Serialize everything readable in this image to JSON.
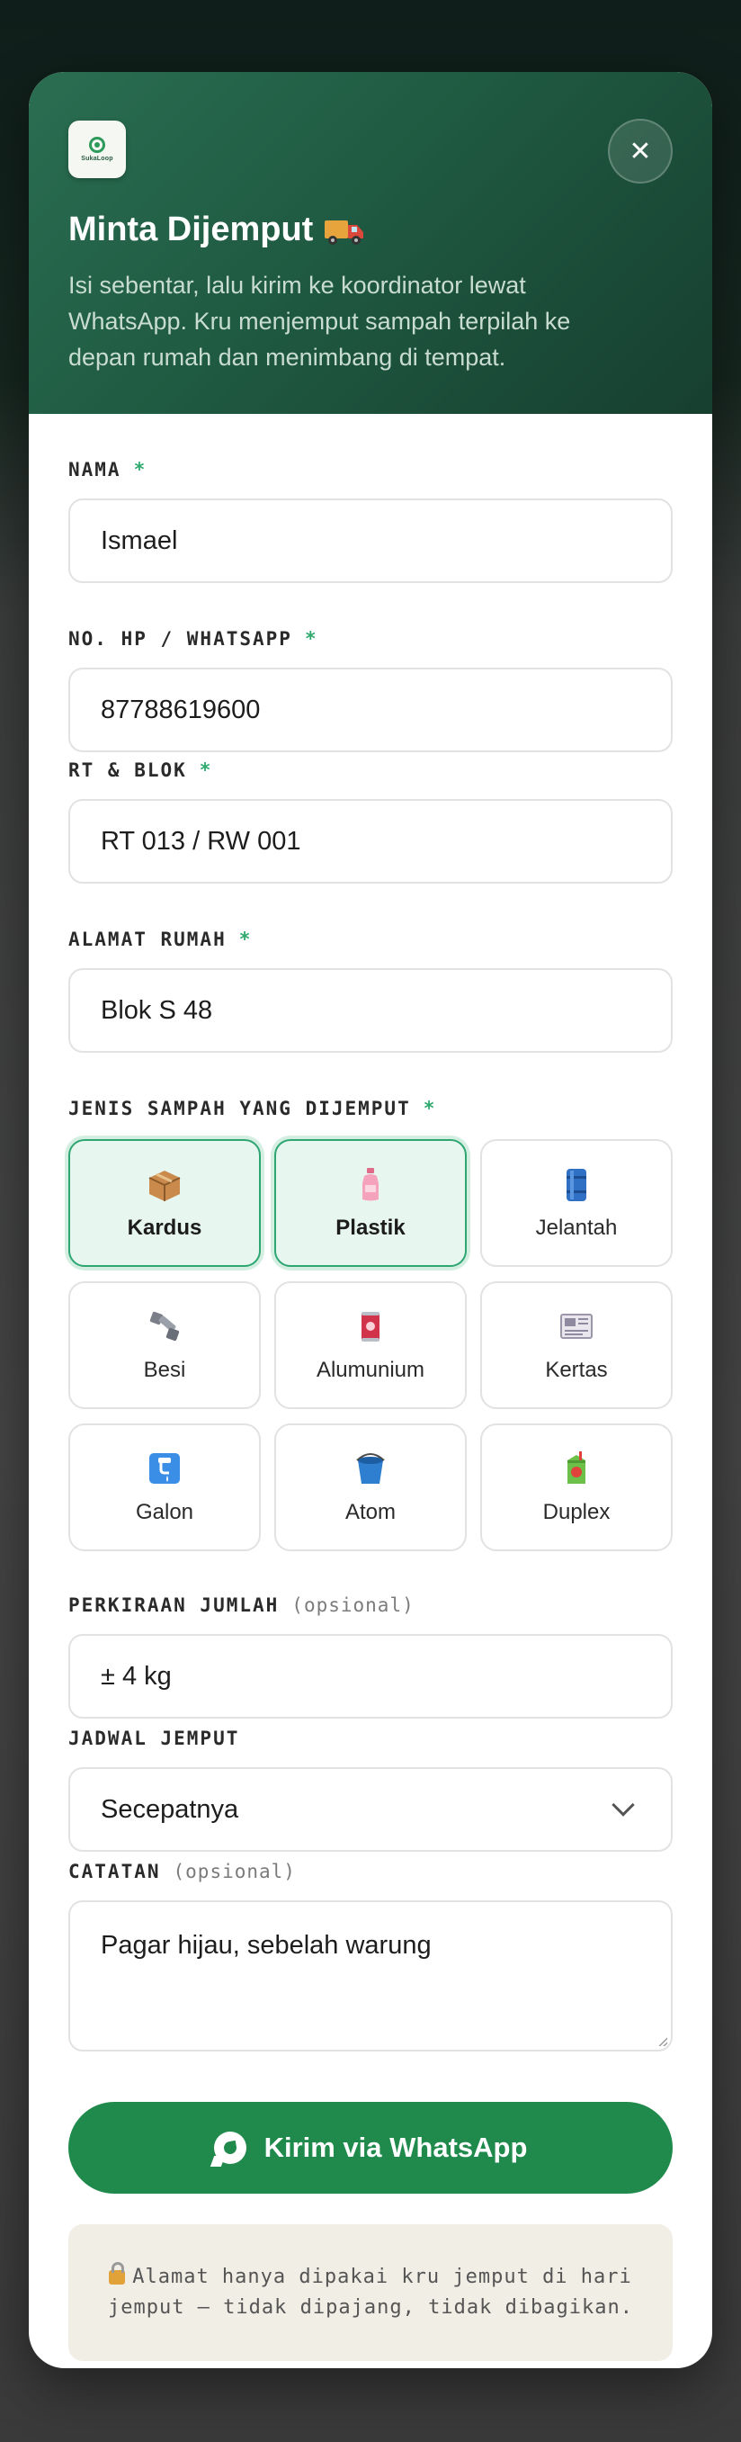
{
  "header": {
    "logo_text": "SukaLoop",
    "title": "Minta Dijemput",
    "subtitle": "Isi sebentar, lalu kirim ke koordinator lewat WhatsApp. Kru menjemput sampah terpilah ke depan rumah dan menimbang di tempat.",
    "close_label": "✕",
    "title_icon": "truck-icon"
  },
  "form": {
    "name": {
      "label": "NAMA",
      "required": "*",
      "value": "Ismael"
    },
    "phone": {
      "label": "NO. HP / WHATSAPP",
      "required": "*",
      "value": "87788619600"
    },
    "rt": {
      "label": "RT & BLOK",
      "required": "*",
      "value": "RT 013 / RW 001"
    },
    "address": {
      "label": "ALAMAT RUMAH",
      "required": "*",
      "value": "Blok S 48"
    },
    "waste_types": {
      "label": "JENIS SAMPAH YANG DIJEMPUT",
      "required": "*",
      "items": [
        {
          "label": "Kardus",
          "icon": "box-icon",
          "selected": true
        },
        {
          "label": "Plastik",
          "icon": "plastic-bottle-icon",
          "selected": true
        },
        {
          "label": "Jelantah",
          "icon": "oil-barrel-icon",
          "selected": false
        },
        {
          "label": "Besi",
          "icon": "metal-bolt-icon",
          "selected": false
        },
        {
          "label": "Alumunium",
          "icon": "can-icon",
          "selected": false
        },
        {
          "label": "Kertas",
          "icon": "newspaper-icon",
          "selected": false
        },
        {
          "label": "Galon",
          "icon": "water-jug-icon",
          "selected": false
        },
        {
          "label": "Atom",
          "icon": "bucket-icon",
          "selected": false
        },
        {
          "label": "Duplex",
          "icon": "juice-box-icon",
          "selected": false
        }
      ]
    },
    "amount": {
      "label": "PERKIRAAN JUMLAH",
      "optional": "(opsional)",
      "value": "± 4 kg"
    },
    "schedule": {
      "label": "JADWAL JEMPUT",
      "value": "Secepatnya"
    },
    "notes": {
      "label": "CATATAN",
      "optional": "(opsional)",
      "value": "Pagar hijau, sebelah warung"
    }
  },
  "submit": {
    "label": "Kirim via WhatsApp"
  },
  "privacy_note": "Alamat hanya dipakai kru jemput di hari jemput — tidak dipajang, tidak dibagikan.",
  "colors": {
    "primary": "#1f8a4c",
    "header": "#1f5a42",
    "accent": "#2eaa6e"
  }
}
